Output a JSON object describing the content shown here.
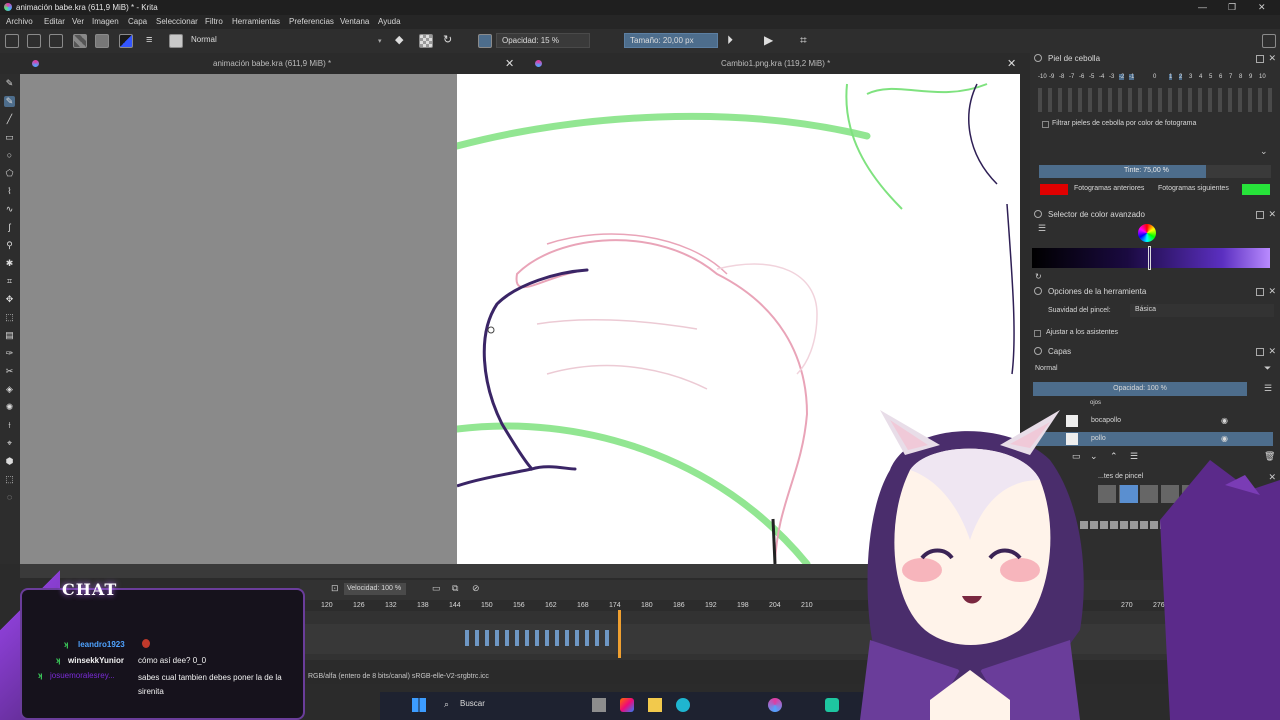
{
  "window": {
    "title": "animación babe.kra (611,9 MiB) * - Krita"
  },
  "menu": [
    "Archivo",
    "Editar",
    "Ver",
    "Imagen",
    "Capa",
    "Seleccionar",
    "Filtro",
    "Herramientas",
    "Preferencias",
    "Ventana",
    "Ayuda"
  ],
  "toolbar": {
    "blend_mode": "Normal",
    "opacity": "Opacidad: 15 %",
    "size": "Tamaño: 20,00 px"
  },
  "tabs": {
    "left": "animación babe.kra (611,9 MiB) *",
    "right": "Cambio1.png.kra (119,2 MiB) *"
  },
  "onion": {
    "title": "Piel de cebolla",
    "scale": [
      "-10",
      "-9",
      "-8",
      "-7",
      "-6",
      "-5",
      "-4",
      "-3",
      "-2",
      "-1",
      "0",
      "1",
      "2",
      "3",
      "4",
      "5",
      "6",
      "7",
      "8",
      "9",
      "10"
    ],
    "filter_label": "Filtrar pieles de cebolla por color de fotograma",
    "tint": "Tinte: 75,00 %",
    "prev_label": "Fotogramas anteriores",
    "next_label": "Fotogramas siguientes",
    "prev_color": "#e00000",
    "next_color": "#27e33a"
  },
  "color_selector": {
    "title": "Selector de color avanzado"
  },
  "tool_options": {
    "title": "Opciones de la herramienta",
    "smoothing_label": "Suavidad del pincel:",
    "smoothing_value": "Básica",
    "assist_label": "Ajustar a los asistentes"
  },
  "layers": {
    "title": "Capas",
    "blend": "Normal",
    "opacity": "Opacidad:  100 %",
    "items": [
      {
        "name": "ojos",
        "selected": false
      },
      {
        "name": "bocapollo",
        "selected": false
      },
      {
        "name": "pollo",
        "selected": true
      }
    ]
  },
  "brushes": {
    "title": "...tes de pincel"
  },
  "timeline": {
    "speed": "Velocidad: 100 %",
    "ruler": [
      "120",
      "126",
      "132",
      "138",
      "144",
      "150",
      "156",
      "162",
      "168",
      "174",
      "180",
      "186",
      "192",
      "198",
      "204",
      "210",
      "270",
      "276"
    ]
  },
  "statusbar": {
    "text": "RGB/alfa (entero de 8 bits/canal)  sRGB-elle-V2-srgbtrc.icc"
  },
  "taskbar": {
    "search": "Buscar"
  },
  "chat": {
    "title": "CHAT",
    "messages": [
      {
        "user": "leandro1923",
        "text": "",
        "user_color": "#4fa3ff"
      },
      {
        "user": "winsekkYunior",
        "text": "cómo así dee? 0_0",
        "user_color": "#f2f2f2"
      },
      {
        "user": "josuemoralesrey...",
        "text": "sabes cual tambien debes poner la de la sirenita",
        "user_color": "#7a2bd6"
      }
    ]
  },
  "colors": {
    "accent": "#4d6d8c",
    "purple": "#6a3d9a",
    "playhead": "#f0a030"
  }
}
